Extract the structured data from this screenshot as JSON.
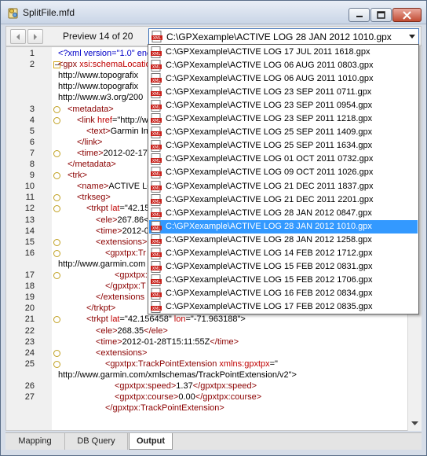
{
  "window": {
    "title": "SplitFile.mfd",
    "buttons": {
      "minimize": "minimize-icon",
      "maximize": "maximize-icon",
      "close": "close-icon"
    }
  },
  "toolbar": {
    "preview_label": "Preview 14 of 20",
    "selected_file": "C:\\GPXexample\\ACTIVE LOG 28 JAN 2012 1010.gpx"
  },
  "dropdown": {
    "items": [
      "C:\\GPXexample\\ACTIVE LOG 17 JUL 2011 1618.gpx",
      "C:\\GPXexample\\ACTIVE LOG 06 AUG 2011 0803.gpx",
      "C:\\GPXexample\\ACTIVE LOG 06 AUG 2011 1010.gpx",
      "C:\\GPXexample\\ACTIVE LOG 23 SEP 2011 0711.gpx",
      "C:\\GPXexample\\ACTIVE LOG 23 SEP 2011 0954.gpx",
      "C:\\GPXexample\\ACTIVE LOG 23 SEP 2011 1218.gpx",
      "C:\\GPXexample\\ACTIVE LOG 25 SEP 2011 1409.gpx",
      "C:\\GPXexample\\ACTIVE LOG 25 SEP 2011 1634.gpx",
      "C:\\GPXexample\\ACTIVE LOG 01 OCT 2011 0732.gpx",
      "C:\\GPXexample\\ACTIVE LOG 09 OCT 2011 1026.gpx",
      "C:\\GPXexample\\ACTIVE LOG 21 DEC 2011 1837.gpx",
      "C:\\GPXexample\\ACTIVE LOG 21 DEC 2011 2201.gpx",
      "C:\\GPXexample\\ACTIVE LOG 28 JAN 2012 0847.gpx",
      "C:\\GPXexample\\ACTIVE LOG 28 JAN 2012 1010.gpx",
      "C:\\GPXexample\\ACTIVE LOG 28 JAN 2012 1258.gpx",
      "C:\\GPXexample\\ACTIVE LOG 14 FEB 2012 1712.gpx",
      "C:\\GPXexample\\ACTIVE LOG 15 FEB 2012 0831.gpx",
      "C:\\GPXexample\\ACTIVE LOG 15 FEB 2012 1706.gpx",
      "C:\\GPXexample\\ACTIVE LOG 16 FEB 2012 0834.gpx",
      "C:\\GPXexample\\ACTIVE LOG 17 FEB 2012 0835.gpx"
    ],
    "selected_index": 13
  },
  "editor": {
    "line_numbers": [
      "1",
      "2",
      "",
      "",
      "",
      "3",
      "4",
      "5",
      "6",
      "7",
      "8",
      "9",
      "10",
      "11",
      "12",
      "13",
      "14",
      "15",
      "16",
      "",
      "17",
      "18",
      "19",
      "20",
      "21",
      "22",
      "23",
      "24",
      "25",
      "",
      "26",
      "27",
      ""
    ],
    "lines": [
      {
        "indent": 0,
        "parts": [
          [
            "pi",
            "<?xml version=\"1.0\" enc"
          ]
        ]
      },
      {
        "indent": 0,
        "parts": [
          [
            "tag",
            "<gpx "
          ],
          [
            "attr",
            "xsi:schemaLocatio"
          ]
        ]
      },
      {
        "indent": -1,
        "parts": [
          [
            "txt",
            "http://www.topografix"
          ]
        ]
      },
      {
        "indent": -1,
        "parts": [
          [
            "txt",
            "http://www.topografix"
          ]
        ]
      },
      {
        "indent": -1,
        "parts": [
          [
            "txt",
            "http://www.w3.org/200"
          ]
        ]
      },
      {
        "indent": 1,
        "parts": [
          [
            "tag",
            "<metadata>"
          ]
        ]
      },
      {
        "indent": 2,
        "parts": [
          [
            "tag",
            "<link "
          ],
          [
            "attr",
            "href"
          ],
          [
            "txt",
            "=\"http://w"
          ]
        ]
      },
      {
        "indent": 3,
        "parts": [
          [
            "tag",
            "<text>"
          ],
          [
            "txt",
            "Garmin In"
          ]
        ]
      },
      {
        "indent": 2,
        "parts": [
          [
            "tag",
            "</link>"
          ]
        ]
      },
      {
        "indent": 2,
        "parts": [
          [
            "tag",
            "<time>"
          ],
          [
            "txt",
            "2012-02-17"
          ]
        ]
      },
      {
        "indent": 1,
        "parts": [
          [
            "tag",
            "</metadata>"
          ]
        ]
      },
      {
        "indent": 1,
        "parts": [
          [
            "tag",
            "<trk>"
          ]
        ]
      },
      {
        "indent": 2,
        "parts": [
          [
            "tag",
            "<name>"
          ],
          [
            "txt",
            "ACTIVE LO"
          ]
        ]
      },
      {
        "indent": 2,
        "parts": [
          [
            "tag",
            "<trkseg>"
          ]
        ]
      },
      {
        "indent": 3,
        "parts": [
          [
            "tag",
            "<trkpt "
          ],
          [
            "attr",
            "lat"
          ],
          [
            "txt",
            "=\"42.15"
          ]
        ]
      },
      {
        "indent": 4,
        "parts": [
          [
            "tag",
            "<ele>"
          ],
          [
            "txt",
            "267.86<"
          ]
        ]
      },
      {
        "indent": 4,
        "parts": [
          [
            "tag",
            "<time>"
          ],
          [
            "txt",
            "2012-0"
          ]
        ]
      },
      {
        "indent": 4,
        "parts": [
          [
            "tag",
            "<extensions>"
          ]
        ]
      },
      {
        "indent": 5,
        "parts": [
          [
            "tag",
            "<gpxtpx:Tr"
          ]
        ]
      },
      {
        "indent": -1,
        "parts": [
          [
            "txt",
            "http://www.garmin.com"
          ]
        ]
      },
      {
        "indent": 6,
        "parts": [
          [
            "tag",
            "<gpxtpx:"
          ]
        ]
      },
      {
        "indent": 5,
        "parts": [
          [
            "tag",
            "</gpxtpx:T"
          ]
        ]
      },
      {
        "indent": 4,
        "parts": [
          [
            "tag",
            "</extensions"
          ]
        ]
      },
      {
        "indent": 3,
        "parts": [
          [
            "tag",
            "</trkpt>"
          ]
        ]
      },
      {
        "indent": 3,
        "parts": [
          [
            "tag",
            "<trkpt "
          ],
          [
            "attr",
            "lat"
          ],
          [
            "txt",
            "=\"42.156458\" "
          ],
          [
            "attr",
            "lon"
          ],
          [
            "txt",
            "=\"-71.963188\">"
          ]
        ]
      },
      {
        "indent": 4,
        "parts": [
          [
            "tag",
            "<ele>"
          ],
          [
            "txt",
            "268.35"
          ],
          [
            "tag",
            "</ele>"
          ]
        ]
      },
      {
        "indent": 4,
        "parts": [
          [
            "tag",
            "<time>"
          ],
          [
            "txt",
            "2012-01-28T15:11:55Z"
          ],
          [
            "tag",
            "</time>"
          ]
        ]
      },
      {
        "indent": 4,
        "parts": [
          [
            "tag",
            "<extensions>"
          ]
        ]
      },
      {
        "indent": 5,
        "parts": [
          [
            "tag",
            "<gpxtpx:TrackPointExtension "
          ],
          [
            "attr",
            "xmlns:gpxtpx"
          ],
          [
            "txt",
            "=\""
          ]
        ]
      },
      {
        "indent": -1,
        "parts": [
          [
            "txt",
            "http://www.garmin.com/xmlschemas/TrackPointExtension/v2\">"
          ]
        ]
      },
      {
        "indent": 6,
        "parts": [
          [
            "tag",
            "<gpxtpx:speed>"
          ],
          [
            "txt",
            "1.37"
          ],
          [
            "tag",
            "</gpxtpx:speed>"
          ]
        ]
      },
      {
        "indent": 6,
        "parts": [
          [
            "tag",
            "<gpxtpx:course>"
          ],
          [
            "txt",
            "0.00"
          ],
          [
            "tag",
            "</gpxtpx:course>"
          ]
        ]
      },
      {
        "indent": 5,
        "parts": [
          [
            "tag",
            "</gpxtpx:TrackPointExtension>"
          ]
        ]
      }
    ]
  },
  "tabs": [
    {
      "label": "Mapping",
      "active": false
    },
    {
      "label": "DB Query",
      "active": false
    },
    {
      "label": "Output",
      "active": true
    }
  ],
  "colors": {
    "selection": "#3399ff",
    "tag": "#8b0000",
    "attr": "#c00000",
    "value": "#0000c8"
  }
}
